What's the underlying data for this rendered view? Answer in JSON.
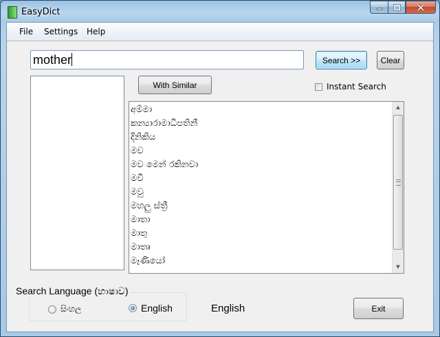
{
  "window": {
    "title": "EasyDict"
  },
  "menu": {
    "file": "File",
    "settings": "Settings",
    "help": "Help"
  },
  "search": {
    "value": "mother"
  },
  "buttons": {
    "search": "Search >>",
    "clear": "Clear",
    "with_similar": "With Similar",
    "exit": "Exit"
  },
  "options": {
    "instant_search": "Instant Search",
    "instant_search_checked": false
  },
  "results": [
    "අම්මා",
    "කන්‍යාරාමාධිපතිනී",
    "දිනිකිය",
    "මව",
    "මව මෙන් රකිනවා",
    "මවී",
    "මවු",
    "මහලු ස්ත්‍රී",
    "මාතා",
    "මාතු",
    "මාතෘ",
    "මෑණියෝ"
  ],
  "language_group": {
    "title": "Search Language (භාෂාව)",
    "sinhala_label": "සිංහල",
    "english_label": "English",
    "selected": "English"
  },
  "current_language_label": "English",
  "icons": {
    "app": "dictionary-book-icon",
    "minimize": "minimize-icon",
    "maximize": "maximize-icon",
    "close": "close-icon"
  },
  "colors": {
    "accent": "#3c7fb1",
    "close_button": "#c7452b"
  }
}
